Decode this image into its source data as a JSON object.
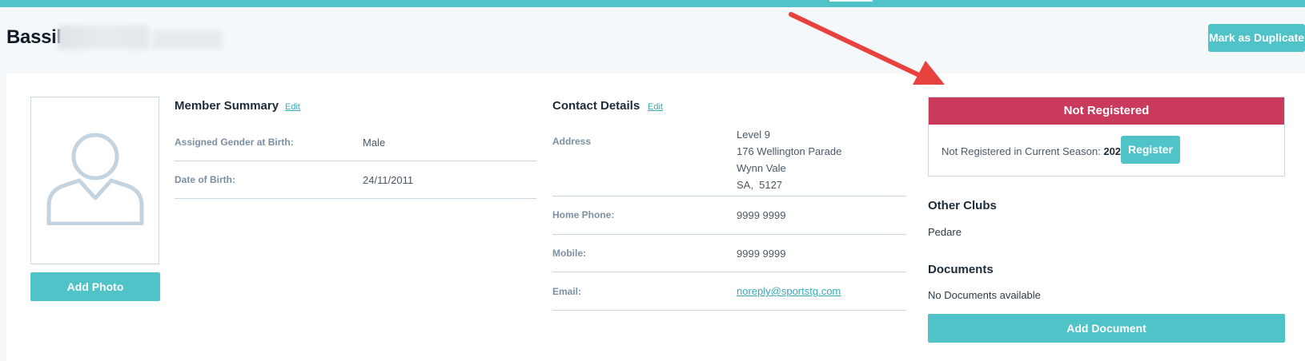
{
  "header": {
    "title": "Bassil",
    "mark_duplicate_label": "Mark as Duplicate"
  },
  "photo": {
    "add_photo_label": "Add Photo"
  },
  "member_summary": {
    "title": "Member Summary",
    "edit_label": "Edit",
    "rows": [
      {
        "label": "Assigned Gender at Birth:",
        "value": "Male"
      },
      {
        "label": "Date of Birth:",
        "value": "24/11/2011"
      }
    ]
  },
  "contact_details": {
    "title": "Contact Details",
    "edit_label": "Edit",
    "address_label": "Address",
    "address_lines": [
      "Level 9",
      "176 Wellington Parade",
      "Wynn Vale",
      "SA,  5127"
    ],
    "home_phone_label": "Home Phone:",
    "home_phone": "9999 9999",
    "mobile_label": "Mobile:",
    "mobile": "9999 9999",
    "email_label": "Email:",
    "email": "noreply@sportstg.com"
  },
  "registration": {
    "status": "Not Registered",
    "message": "Not Registered in Current Season:",
    "season": "2021",
    "register_label": "Register"
  },
  "other_clubs": {
    "title": "Other Clubs",
    "clubs": [
      "Pedare"
    ]
  },
  "documents": {
    "title": "Documents",
    "empty_text": "No Documents available",
    "add_label": "Add Document"
  },
  "colors": {
    "accent": "#4fc3c8",
    "not_registered": "#c93a5d",
    "annotation_arrow": "#e8423f"
  }
}
